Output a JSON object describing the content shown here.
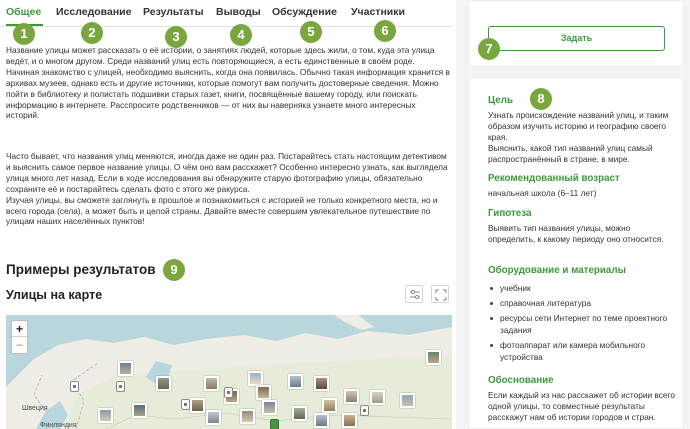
{
  "tabs": [
    {
      "label": "Общее",
      "active": true
    },
    {
      "label": "Исследование",
      "active": false
    },
    {
      "label": "Результаты",
      "active": false
    },
    {
      "label": "Выводы",
      "active": false
    },
    {
      "label": "Обсуждение",
      "active": false
    },
    {
      "label": "Участники",
      "active": false
    }
  ],
  "annotations": [
    "1",
    "2",
    "3",
    "4",
    "5",
    "6",
    "7",
    "8",
    "9"
  ],
  "intro": {
    "group1": [
      "Название улицы может рассказать о её истории, о занятиях людей, которые здесь жили, о том, куда эта улица ведёт, и о многом другом. Среди названий улиц есть повторяющиеся, а есть единственные в своём роде.",
      "Начиная знакомство с улицей, необходимо выяснить, когда она появилась. Обычно такая информация хранится в архивах музеев, однако есть и другие источники, которые помогут вам получить достоверные сведения. Можно пойти в библиотеку и полистать подшивки старых газет, книги, посвящённые вашему городу, или поискать информацию в интернете. Расспросите родственников — от них вы наверняка узнаете много интересных историй."
    ],
    "group2": [
      "Часто бывает, что названия улиц меняются, иногда даже не один раз. Постарайтесь стать настоящим детективом и выяснить самое первое название улицы. О чём оно вам расскажет? Особенно интересно узнать, как выглядела улица много лет назад. Если в ходе исследования вы обнаружите старую фотографию улицы, обязательно сохраните её и постарайтесь сделать фото с этого же ракурса.",
      "Изучая улицы, вы сможете заглянуть в прошлое и познакомиться с историей не только конкретного места, но и всего города (села), а может быть и целой страны. Давайте вместе совершим увлекательное путешествие по улицам наших населённых пунктов!"
    ]
  },
  "results": {
    "title": "Примеры результатов",
    "map_title": "Улицы на карте",
    "filter_icon": "sliders-icon",
    "fullscreen_icon": "fullscreen-icon"
  },
  "map": {
    "zoom_in": "+",
    "zoom_out": "−",
    "labels": [
      "Швеция",
      "Финляндия"
    ]
  },
  "sidebar": {
    "ask_button": "Задать",
    "goal": {
      "title": "Цель",
      "text": [
        "Узнать происхождение названий улиц, и таким образом изучить историю и географию своего края.",
        "Выяснить, какой тип названий улиц самый распространённый в стране, в мире."
      ]
    },
    "age": {
      "title": "Рекомендованный возраст",
      "text": "начальная школа (6–11 лет)"
    },
    "hypothesis": {
      "title": "Гипотеза",
      "text": "Выявить тип названия улицы, можно определить, к какому периоду оно относится."
    },
    "equipment": {
      "title": "Оборудование и материалы",
      "items": [
        "учебник",
        "справочная литература",
        "ресурсы сети Интернет по теме проектного задания",
        "фотоаппарат или камера мобильного устройства"
      ]
    },
    "rationale": {
      "title": "Обоснование",
      "text": "Если каждый из нас расскажет об истории всего одной улицы, то совместные результаты расскажут нам об истории городов и стран."
    }
  },
  "colors": {
    "accent": "#3d9a3a",
    "annotation": "#7aa63e",
    "sidebar_bg": "#f4f4f4"
  }
}
